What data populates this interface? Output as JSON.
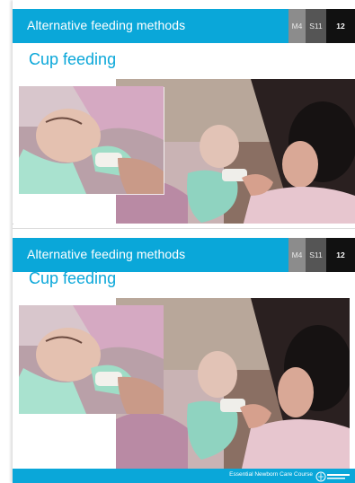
{
  "slides": [
    {
      "header_title": "Alternative feeding methods",
      "tag_module": "M4",
      "tag_section": "S11",
      "tag_number": "12",
      "title": "Cup feeding"
    },
    {
      "header_title": "Alternative feeding methods",
      "tag_module": "M4",
      "tag_section": "S11",
      "tag_number": "12",
      "title": "Cup feeding",
      "footer_text": "Essential Newborn Care Course"
    }
  ],
  "colors": {
    "accent": "#0aa7d9",
    "tag_module_bg": "#8c8c8c",
    "tag_section_bg": "#555555",
    "tag_number_bg": "#111111"
  },
  "icons": [
    "who-logo-icon"
  ]
}
